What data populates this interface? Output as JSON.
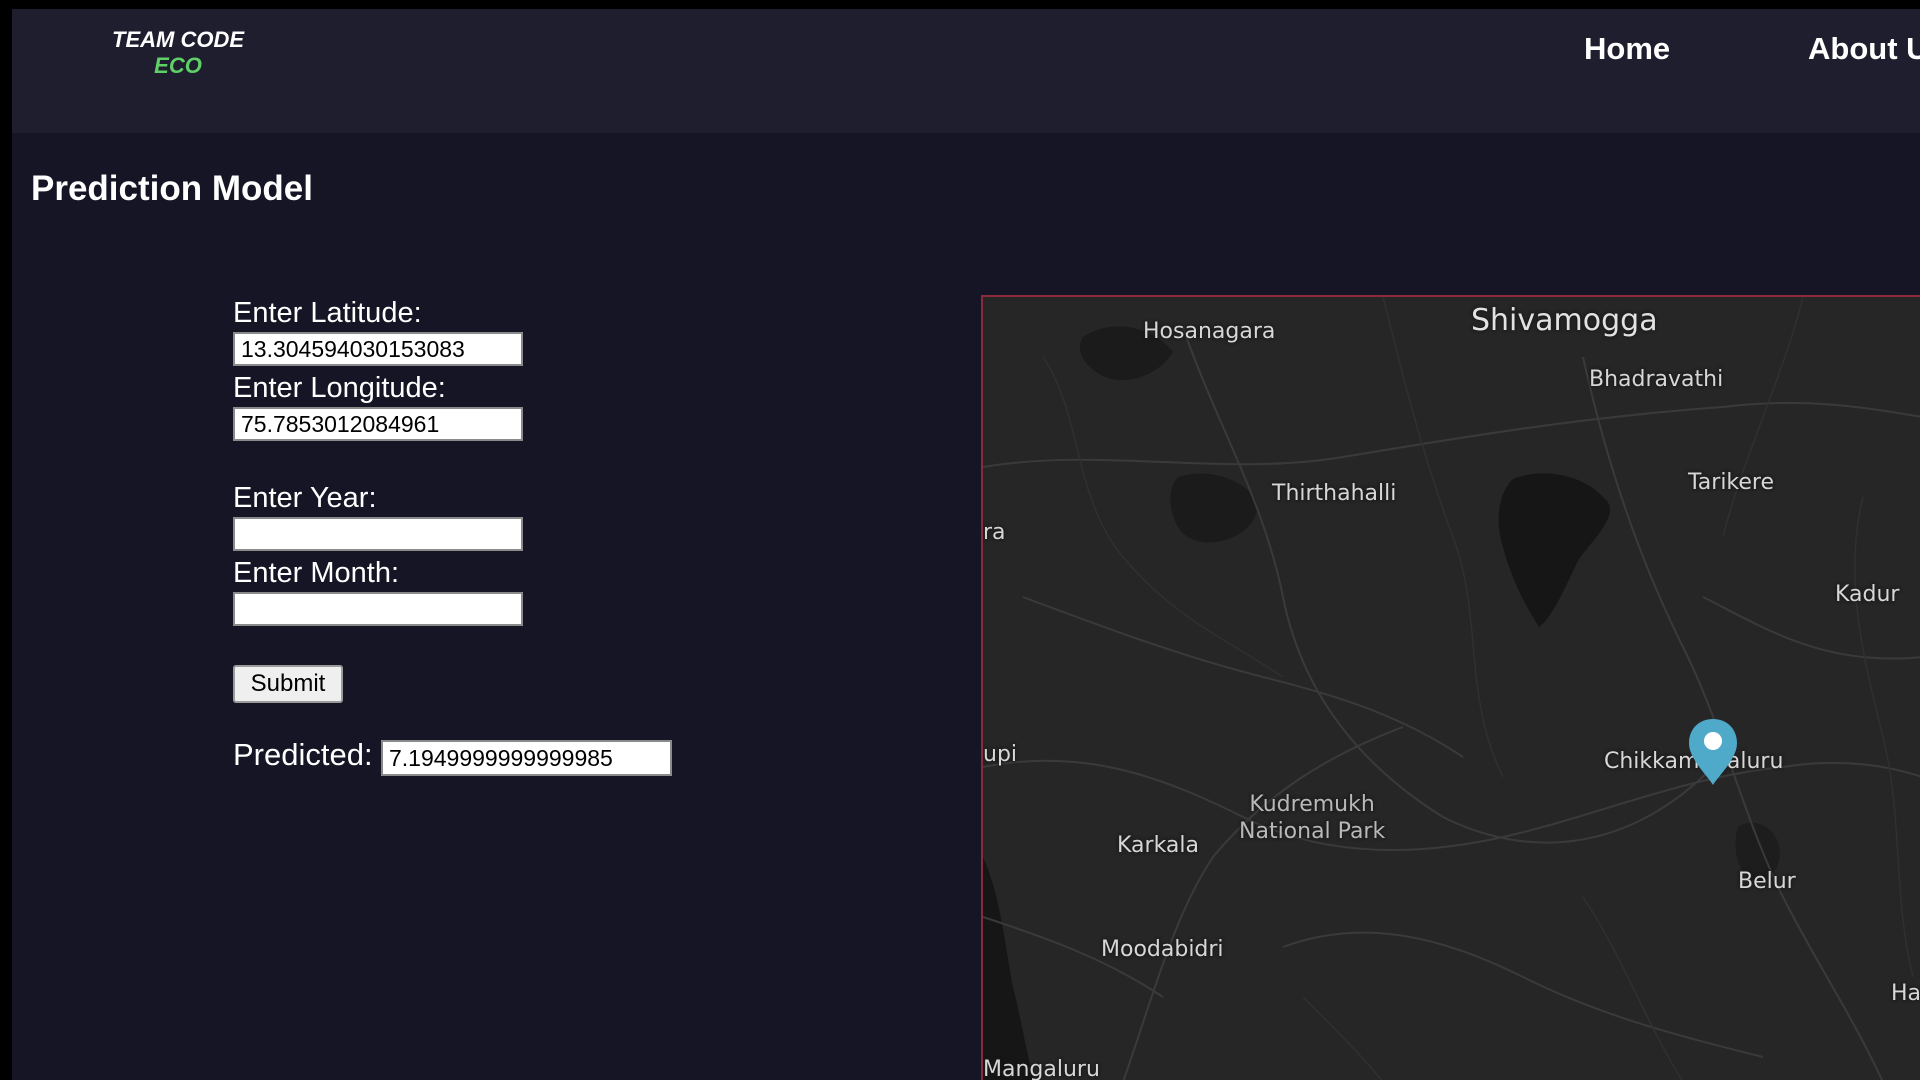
{
  "navbar": {
    "logo_line1": "TEAM CODE",
    "logo_line2": "ECO",
    "links": {
      "home": "Home",
      "about": "About U"
    }
  },
  "page": {
    "title": "Prediction Model"
  },
  "form": {
    "latitude_label": "Enter Latitude:",
    "latitude_value": "13.304594030153083",
    "longitude_label": "Enter Longitude:",
    "longitude_value": "75.7853012084961",
    "year_label": "Enter Year:",
    "year_value": "",
    "month_label": "Enter Month:",
    "month_value": "",
    "submit_label": "Submit",
    "predicted_label": "Predicted:",
    "predicted_value": "7.1949999999999985"
  },
  "map": {
    "labels": {
      "shivamogga": "Shivamogga",
      "hosanagara": "Hosanagara",
      "bhadravathi": "Bhadravathi",
      "thirthahalli": "Thirthahalli",
      "tarikere": "Tarikere",
      "kadur": "Kadur",
      "ra": "ra",
      "upi": "upi",
      "chikkamagaluru": "Chikkamagaluru",
      "kudremukh_line1": "Kudremukh",
      "kudremukh_line2": "National Park",
      "karkala": "Karkala",
      "belur": "Belur",
      "moodabidri": "Moodabidri",
      "ha": "Ha",
      "mangaluru": "Mangaluru"
    },
    "marker_color": "#4fa9c9",
    "background_color": "#262626"
  },
  "colors": {
    "page_background": "#161525",
    "navbar_background": "#1f1e2e",
    "logo_accent": "#5fd068",
    "map_border": "#8a2a3a"
  }
}
